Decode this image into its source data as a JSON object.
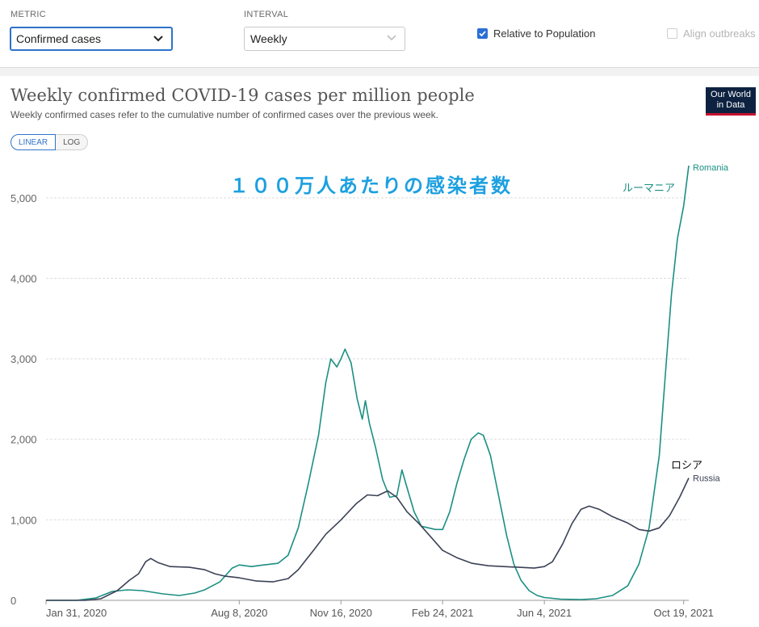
{
  "controls": {
    "metric_label": "METRIC",
    "metric_value": "Confirmed cases",
    "interval_label": "INTERVAL",
    "interval_value": "Weekly",
    "relative_label": "Relative to Population",
    "relative_checked": true,
    "align_label": "Align outbreaks",
    "align_checked": false
  },
  "logo": {
    "line1": "Our World",
    "line2": "in Data"
  },
  "scale_toggle": {
    "linear": "LINEAR",
    "log": "LOG",
    "active": "linear"
  },
  "annotations": {
    "main": "１００万人あたりの感染者数",
    "romania_jp": "ルーマニア",
    "russia_jp": "ロシア"
  },
  "chart_data": {
    "type": "line",
    "title": "Weekly confirmed COVID-19 cases per million people",
    "subtitle": "Weekly confirmed cases refer to the cumulative number of confirmed cases over the previous week.",
    "xlabel": "",
    "ylabel": "",
    "x_range": [
      "2020-01-31",
      "2021-10-24"
    ],
    "ylim": [
      0,
      5500
    ],
    "y_ticks": [
      0,
      1000,
      2000,
      3000,
      4000,
      5000
    ],
    "y_tick_labels": [
      "0",
      "1,000",
      "2,000",
      "3,000",
      "4,000",
      "5,000"
    ],
    "x_ticks": [
      "2020-01-31",
      "2020-08-08",
      "2020-11-16",
      "2021-02-24",
      "2021-06-04",
      "2021-10-19"
    ],
    "x_tick_labels": [
      "Jan 31, 2020",
      "Aug 8, 2020",
      "Nov 16, 2020",
      "Feb 24, 2021",
      "Jun 4, 2021",
      "Oct 19, 2021"
    ],
    "grid": true,
    "legend": "line-end labels",
    "series": [
      {
        "name": "Romania",
        "color": "#1b8f83",
        "points": [
          [
            "2020-01-31",
            0
          ],
          [
            "2020-03-01",
            0
          ],
          [
            "2020-03-20",
            30
          ],
          [
            "2020-04-05",
            110
          ],
          [
            "2020-04-20",
            130
          ],
          [
            "2020-05-05",
            120
          ],
          [
            "2020-05-25",
            80
          ],
          [
            "2020-06-10",
            60
          ],
          [
            "2020-06-25",
            90
          ],
          [
            "2020-07-05",
            130
          ],
          [
            "2020-07-20",
            230
          ],
          [
            "2020-08-01",
            400
          ],
          [
            "2020-08-08",
            440
          ],
          [
            "2020-08-20",
            420
          ],
          [
            "2020-09-01",
            440
          ],
          [
            "2020-09-15",
            460
          ],
          [
            "2020-09-25",
            560
          ],
          [
            "2020-10-05",
            900
          ],
          [
            "2020-10-15",
            1450
          ],
          [
            "2020-10-25",
            2050
          ],
          [
            "2020-11-01",
            2700
          ],
          [
            "2020-11-06",
            3000
          ],
          [
            "2020-11-12",
            2900
          ],
          [
            "2020-11-16",
            3000
          ],
          [
            "2020-11-20",
            3120
          ],
          [
            "2020-11-26",
            2950
          ],
          [
            "2020-12-02",
            2500
          ],
          [
            "2020-12-07",
            2250
          ],
          [
            "2020-12-10",
            2480
          ],
          [
            "2020-12-14",
            2200
          ],
          [
            "2020-12-20",
            1900
          ],
          [
            "2020-12-27",
            1500
          ],
          [
            "2021-01-03",
            1280
          ],
          [
            "2021-01-10",
            1300
          ],
          [
            "2021-01-15",
            1620
          ],
          [
            "2021-01-20",
            1400
          ],
          [
            "2021-01-27",
            1100
          ],
          [
            "2021-02-03",
            920
          ],
          [
            "2021-02-10",
            900
          ],
          [
            "2021-02-17",
            880
          ],
          [
            "2021-02-24",
            880
          ],
          [
            "2021-03-03",
            1100
          ],
          [
            "2021-03-10",
            1450
          ],
          [
            "2021-03-17",
            1750
          ],
          [
            "2021-03-24",
            2000
          ],
          [
            "2021-03-31",
            2080
          ],
          [
            "2021-04-05",
            2050
          ],
          [
            "2021-04-12",
            1800
          ],
          [
            "2021-04-20",
            1300
          ],
          [
            "2021-04-28",
            800
          ],
          [
            "2021-05-05",
            450
          ],
          [
            "2021-05-12",
            250
          ],
          [
            "2021-05-20",
            120
          ],
          [
            "2021-05-28",
            60
          ],
          [
            "2021-06-04",
            35
          ],
          [
            "2021-06-20",
            15
          ],
          [
            "2021-07-10",
            10
          ],
          [
            "2021-07-25",
            20
          ],
          [
            "2021-08-10",
            60
          ],
          [
            "2021-08-25",
            180
          ],
          [
            "2021-09-05",
            450
          ],
          [
            "2021-09-15",
            900
          ],
          [
            "2021-09-25",
            1800
          ],
          [
            "2021-10-01",
            2800
          ],
          [
            "2021-10-07",
            3800
          ],
          [
            "2021-10-13",
            4500
          ],
          [
            "2021-10-19",
            4900
          ],
          [
            "2021-10-24",
            5400
          ]
        ]
      },
      {
        "name": "Russia",
        "color": "#3b4256",
        "points": [
          [
            "2020-01-31",
            0
          ],
          [
            "2020-03-10",
            0
          ],
          [
            "2020-03-25",
            20
          ],
          [
            "2020-04-10",
            120
          ],
          [
            "2020-04-22",
            250
          ],
          [
            "2020-05-01",
            330
          ],
          [
            "2020-05-08",
            480
          ],
          [
            "2020-05-13",
            520
          ],
          [
            "2020-05-20",
            470
          ],
          [
            "2020-06-01",
            420
          ],
          [
            "2020-06-20",
            410
          ],
          [
            "2020-07-05",
            380
          ],
          [
            "2020-07-15",
            330
          ],
          [
            "2020-07-25",
            300
          ],
          [
            "2020-08-08",
            280
          ],
          [
            "2020-08-25",
            240
          ],
          [
            "2020-09-10",
            230
          ],
          [
            "2020-09-25",
            270
          ],
          [
            "2020-10-05",
            380
          ],
          [
            "2020-10-20",
            620
          ],
          [
            "2020-11-01",
            820
          ],
          [
            "2020-11-16",
            1000
          ],
          [
            "2020-12-01",
            1200
          ],
          [
            "2020-12-12",
            1310
          ],
          [
            "2020-12-22",
            1300
          ],
          [
            "2021-01-01",
            1360
          ],
          [
            "2021-01-10",
            1280
          ],
          [
            "2021-01-20",
            1100
          ],
          [
            "2021-02-01",
            950
          ],
          [
            "2021-02-15",
            750
          ],
          [
            "2021-02-24",
            620
          ],
          [
            "2021-03-10",
            530
          ],
          [
            "2021-03-25",
            460
          ],
          [
            "2021-04-10",
            430
          ],
          [
            "2021-04-25",
            420
          ],
          [
            "2021-05-10",
            410
          ],
          [
            "2021-05-25",
            400
          ],
          [
            "2021-06-04",
            420
          ],
          [
            "2021-06-12",
            480
          ],
          [
            "2021-06-22",
            700
          ],
          [
            "2021-07-01",
            950
          ],
          [
            "2021-07-10",
            1130
          ],
          [
            "2021-07-18",
            1170
          ],
          [
            "2021-07-28",
            1130
          ],
          [
            "2021-08-10",
            1040
          ],
          [
            "2021-08-25",
            960
          ],
          [
            "2021-09-05",
            880
          ],
          [
            "2021-09-15",
            860
          ],
          [
            "2021-09-25",
            900
          ],
          [
            "2021-10-05",
            1050
          ],
          [
            "2021-10-15",
            1280
          ],
          [
            "2021-10-24",
            1520
          ]
        ]
      }
    ]
  }
}
